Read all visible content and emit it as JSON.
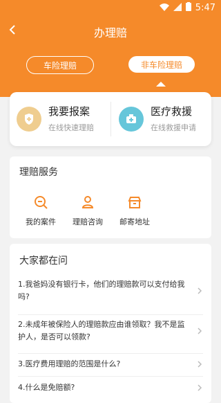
{
  "status_bar": {
    "time": "5:47"
  },
  "header": {
    "title": "办理赔"
  },
  "tabs": [
    {
      "label": "车险理赔"
    },
    {
      "label": "非车险理赔",
      "active": true
    }
  ],
  "quick_actions": [
    {
      "title": "我要报案",
      "subtitle": "在线快速理赔",
      "icon": "report-shield-icon",
      "color": "#efcd8f"
    },
    {
      "title": "医疗救援",
      "subtitle": "在线救援申请",
      "icon": "medical-kit-icon",
      "color": "#66c6da"
    }
  ],
  "service": {
    "heading": "理赔服务",
    "items": [
      {
        "label": "我的案件",
        "icon": "search-case-icon"
      },
      {
        "label": "理赔咨询",
        "icon": "user-consult-icon"
      },
      {
        "label": "邮寄地址",
        "icon": "mail-store-icon"
      }
    ]
  },
  "faq": {
    "heading": "大家都在问",
    "questions": [
      {
        "text": "1.我爸妈没有银行卡，他们的理赔款可以支付给我吗?"
      },
      {
        "text": "2.未成年被保险人的理赔款应由谁领取？我不是监护人，是否可以领款?"
      },
      {
        "text": "3.医疗费用理赔的范围是什么?"
      },
      {
        "text": "4.什么是免赔额?"
      }
    ]
  },
  "colors": {
    "accent": "#f58a2a"
  }
}
